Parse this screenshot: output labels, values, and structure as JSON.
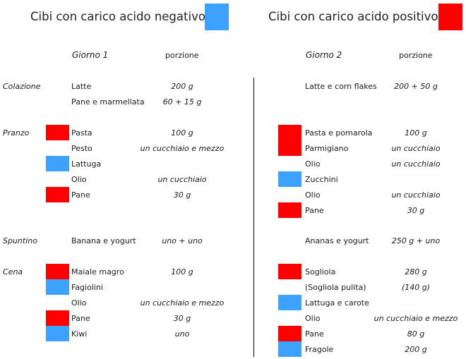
{
  "colors": {
    "negative": "#3da2fe",
    "positive": "#ff0000"
  },
  "legend": {
    "negative_label": "Cibi con carico acido negativo",
    "positive_label": "Cibi con carico acido positivo"
  },
  "day1": {
    "title": "Giorno 1",
    "portion_header": "porzione",
    "meals": {
      "colazione": "Colazione",
      "pranzo": "Pranzo",
      "spuntino": "Spuntino",
      "cena": "Cena"
    },
    "rows": [
      {
        "food": "Latte",
        "qty": "200 g",
        "marker": "none"
      },
      {
        "food": "Pane e marmellata",
        "qty": "60 + 15 g",
        "marker": "none"
      },
      {
        "food": "Pasta",
        "qty": "100 g",
        "marker": "positive"
      },
      {
        "food": "Pesto",
        "qty": "un cucchiaio e mezzo",
        "marker": "none"
      },
      {
        "food": "Lattuga",
        "qty": "",
        "marker": "negative"
      },
      {
        "food": "Olio",
        "qty": "un cucchiaio",
        "marker": "none"
      },
      {
        "food": "Pane",
        "qty": "30 g",
        "marker": "positive"
      },
      {
        "food": "Banana e yogurt",
        "qty": "uno + uno",
        "marker": "none"
      },
      {
        "food": "Maiale magro",
        "qty": "100 g",
        "marker": "positive"
      },
      {
        "food": "Fagiolini",
        "qty": "",
        "marker": "negative"
      },
      {
        "food": "Olio",
        "qty": "un cucchiaio e mezzo",
        "marker": "none"
      },
      {
        "food": "Pane",
        "qty": "30 g",
        "marker": "positive"
      },
      {
        "food": "Kiwi",
        "qty": "uno",
        "marker": "negative"
      }
    ]
  },
  "day2": {
    "title": "Giorno 2",
    "portion_header": "porzione",
    "rows": [
      {
        "food": "Latte e corn flakes",
        "qty": "200 + 50 g",
        "marker": "none"
      },
      {
        "food": "Pasta e pomarola",
        "qty": "100 g",
        "marker": "positive"
      },
      {
        "food": "Parmigiano",
        "qty": "un cucchiaio",
        "marker": "positive"
      },
      {
        "food": "Olio",
        "qty": "un cucchiaio",
        "marker": "none"
      },
      {
        "food": "Zucchini",
        "qty": "",
        "marker": "negative"
      },
      {
        "food": "Olio",
        "qty": "un cucchiaio",
        "marker": "none"
      },
      {
        "food": "Pane",
        "qty": "30 g",
        "marker": "positive"
      },
      {
        "food": "Ananas e yogurt",
        "qty": "250 g + uno",
        "marker": "none"
      },
      {
        "food": "Sogliola",
        "qty": "280 g",
        "marker": "positive"
      },
      {
        "food": "(Sogliola pulita)",
        "qty": "(140 g)",
        "marker": "none"
      },
      {
        "food": "Lattuga e carote",
        "qty": "",
        "marker": "negative"
      },
      {
        "food": "Olio",
        "qty": "un cucchiaio e mezzo",
        "marker": "none"
      },
      {
        "food": "Pane",
        "qty": "80 g",
        "marker": "positive"
      },
      {
        "food": "Fragole",
        "qty": "200 g",
        "marker": "negative"
      }
    ]
  }
}
